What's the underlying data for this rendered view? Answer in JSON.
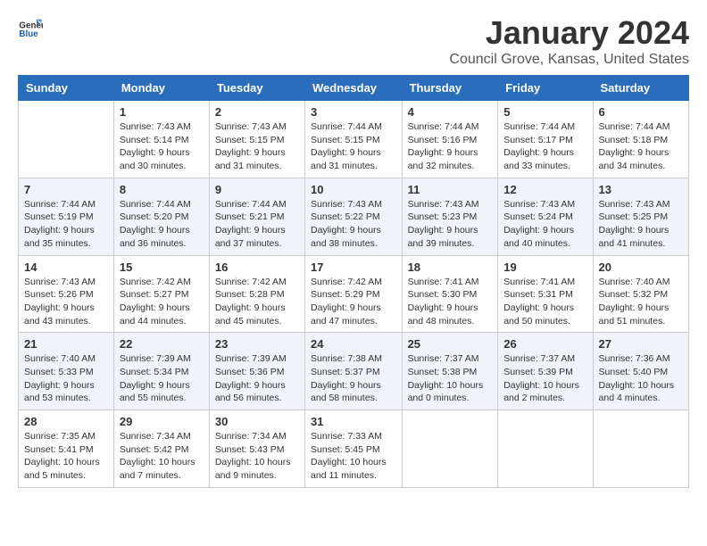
{
  "header": {
    "logo_general": "General",
    "logo_blue": "Blue",
    "title": "January 2024",
    "location": "Council Grove, Kansas, United States"
  },
  "days_of_week": [
    "Sunday",
    "Monday",
    "Tuesday",
    "Wednesday",
    "Thursday",
    "Friday",
    "Saturday"
  ],
  "weeks": [
    [
      {
        "day": "",
        "info": ""
      },
      {
        "day": "1",
        "info": "Sunrise: 7:43 AM\nSunset: 5:14 PM\nDaylight: 9 hours\nand 30 minutes."
      },
      {
        "day": "2",
        "info": "Sunrise: 7:43 AM\nSunset: 5:15 PM\nDaylight: 9 hours\nand 31 minutes."
      },
      {
        "day": "3",
        "info": "Sunrise: 7:44 AM\nSunset: 5:15 PM\nDaylight: 9 hours\nand 31 minutes."
      },
      {
        "day": "4",
        "info": "Sunrise: 7:44 AM\nSunset: 5:16 PM\nDaylight: 9 hours\nand 32 minutes."
      },
      {
        "day": "5",
        "info": "Sunrise: 7:44 AM\nSunset: 5:17 PM\nDaylight: 9 hours\nand 33 minutes."
      },
      {
        "day": "6",
        "info": "Sunrise: 7:44 AM\nSunset: 5:18 PM\nDaylight: 9 hours\nand 34 minutes."
      }
    ],
    [
      {
        "day": "7",
        "info": "Sunrise: 7:44 AM\nSunset: 5:19 PM\nDaylight: 9 hours\nand 35 minutes."
      },
      {
        "day": "8",
        "info": "Sunrise: 7:44 AM\nSunset: 5:20 PM\nDaylight: 9 hours\nand 36 minutes."
      },
      {
        "day": "9",
        "info": "Sunrise: 7:44 AM\nSunset: 5:21 PM\nDaylight: 9 hours\nand 37 minutes."
      },
      {
        "day": "10",
        "info": "Sunrise: 7:43 AM\nSunset: 5:22 PM\nDaylight: 9 hours\nand 38 minutes."
      },
      {
        "day": "11",
        "info": "Sunrise: 7:43 AM\nSunset: 5:23 PM\nDaylight: 9 hours\nand 39 minutes."
      },
      {
        "day": "12",
        "info": "Sunrise: 7:43 AM\nSunset: 5:24 PM\nDaylight: 9 hours\nand 40 minutes."
      },
      {
        "day": "13",
        "info": "Sunrise: 7:43 AM\nSunset: 5:25 PM\nDaylight: 9 hours\nand 41 minutes."
      }
    ],
    [
      {
        "day": "14",
        "info": "Sunrise: 7:43 AM\nSunset: 5:26 PM\nDaylight: 9 hours\nand 43 minutes."
      },
      {
        "day": "15",
        "info": "Sunrise: 7:42 AM\nSunset: 5:27 PM\nDaylight: 9 hours\nand 44 minutes."
      },
      {
        "day": "16",
        "info": "Sunrise: 7:42 AM\nSunset: 5:28 PM\nDaylight: 9 hours\nand 45 minutes."
      },
      {
        "day": "17",
        "info": "Sunrise: 7:42 AM\nSunset: 5:29 PM\nDaylight: 9 hours\nand 47 minutes."
      },
      {
        "day": "18",
        "info": "Sunrise: 7:41 AM\nSunset: 5:30 PM\nDaylight: 9 hours\nand 48 minutes."
      },
      {
        "day": "19",
        "info": "Sunrise: 7:41 AM\nSunset: 5:31 PM\nDaylight: 9 hours\nand 50 minutes."
      },
      {
        "day": "20",
        "info": "Sunrise: 7:40 AM\nSunset: 5:32 PM\nDaylight: 9 hours\nand 51 minutes."
      }
    ],
    [
      {
        "day": "21",
        "info": "Sunrise: 7:40 AM\nSunset: 5:33 PM\nDaylight: 9 hours\nand 53 minutes."
      },
      {
        "day": "22",
        "info": "Sunrise: 7:39 AM\nSunset: 5:34 PM\nDaylight: 9 hours\nand 55 minutes."
      },
      {
        "day": "23",
        "info": "Sunrise: 7:39 AM\nSunset: 5:36 PM\nDaylight: 9 hours\nand 56 minutes."
      },
      {
        "day": "24",
        "info": "Sunrise: 7:38 AM\nSunset: 5:37 PM\nDaylight: 9 hours\nand 58 minutes."
      },
      {
        "day": "25",
        "info": "Sunrise: 7:37 AM\nSunset: 5:38 PM\nDaylight: 10 hours\nand 0 minutes."
      },
      {
        "day": "26",
        "info": "Sunrise: 7:37 AM\nSunset: 5:39 PM\nDaylight: 10 hours\nand 2 minutes."
      },
      {
        "day": "27",
        "info": "Sunrise: 7:36 AM\nSunset: 5:40 PM\nDaylight: 10 hours\nand 4 minutes."
      }
    ],
    [
      {
        "day": "28",
        "info": "Sunrise: 7:35 AM\nSunset: 5:41 PM\nDaylight: 10 hours\nand 5 minutes."
      },
      {
        "day": "29",
        "info": "Sunrise: 7:34 AM\nSunset: 5:42 PM\nDaylight: 10 hours\nand 7 minutes."
      },
      {
        "day": "30",
        "info": "Sunrise: 7:34 AM\nSunset: 5:43 PM\nDaylight: 10 hours\nand 9 minutes."
      },
      {
        "day": "31",
        "info": "Sunrise: 7:33 AM\nSunset: 5:45 PM\nDaylight: 10 hours\nand 11 minutes."
      },
      {
        "day": "",
        "info": ""
      },
      {
        "day": "",
        "info": ""
      },
      {
        "day": "",
        "info": ""
      }
    ]
  ]
}
